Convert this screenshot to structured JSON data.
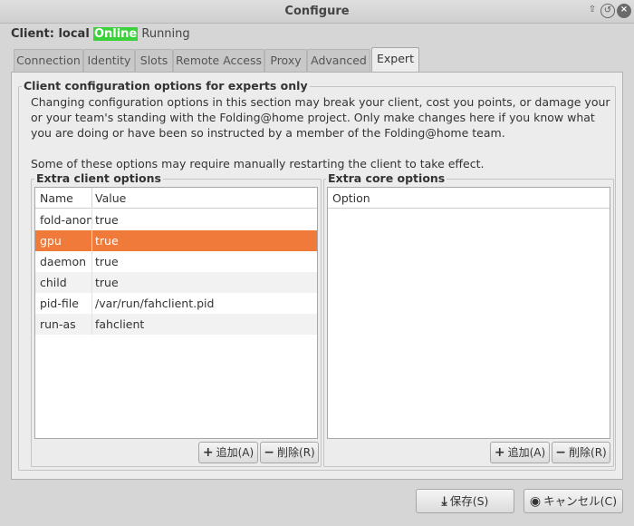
{
  "window": {
    "title": "Configure",
    "buttons": [
      "up",
      "restore",
      "close"
    ]
  },
  "status": {
    "client_label": "Client: local",
    "online": "Online",
    "state": "Running"
  },
  "tabs": [
    {
      "label": "Connection"
    },
    {
      "label": "Identity"
    },
    {
      "label": "Slots"
    },
    {
      "label": "Remote Access"
    },
    {
      "label": "Proxy"
    },
    {
      "label": "Advanced"
    },
    {
      "label": "Expert",
      "active": true
    }
  ],
  "expert": {
    "section_title": "Client configuration options for experts only",
    "warning": "Changing configuration options in this section may break your client, cost you points, or damage your or your team's standing with the Folding@home project.  Only make changes here if you know what you are doing or have been so instructed by a member of the Folding@home team.",
    "restart_note": "Some of these options may require manually restarting the client to take effect."
  },
  "client_options": {
    "title": "Extra client options",
    "columns": [
      "Name",
      "Value"
    ],
    "rows": [
      {
        "name": "fold-anon",
        "value": "true"
      },
      {
        "name": "gpu",
        "value": "true",
        "selected": true
      },
      {
        "name": "daemon",
        "value": "true"
      },
      {
        "name": "child",
        "value": "true"
      },
      {
        "name": "pid-file",
        "value": "/var/run/fahclient.pid"
      },
      {
        "name": "run-as",
        "value": "fahclient"
      }
    ],
    "add_label": "追加(A)",
    "remove_label": "削除(R)"
  },
  "core_options": {
    "title": "Extra core options",
    "columns": [
      "Option"
    ],
    "rows": [],
    "add_label": "追加(A)",
    "remove_label": "削除(R)"
  },
  "footer": {
    "save_label": "保存(S)",
    "cancel_label": "キャンセル(C)"
  },
  "colors": {
    "selection": "#f07a3a",
    "online": "#3bd13b"
  }
}
